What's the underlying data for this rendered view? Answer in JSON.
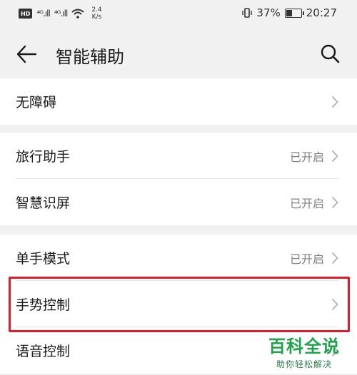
{
  "status_bar": {
    "hd_label": "HD",
    "signal1": "⁴ᴳ.ıll",
    "signal2": "⁴ᴳ.ıll",
    "speed_value": "2.4",
    "speed_unit": "K/s",
    "battery_percent": "37%",
    "battery_level": 0.37,
    "time": "20:27"
  },
  "header": {
    "title": "智能辅助"
  },
  "groups": [
    {
      "items": [
        {
          "label": "无障碍",
          "status": ""
        }
      ]
    },
    {
      "items": [
        {
          "label": "旅行助手",
          "status": "已开启"
        },
        {
          "label": "智慧识屏",
          "status": "已开启"
        }
      ]
    },
    {
      "items": [
        {
          "label": "单手模式",
          "status": "已开启"
        },
        {
          "label": "手势控制",
          "status": ""
        },
        {
          "label": "语音控制",
          "status": ""
        }
      ]
    }
  ],
  "highlighted_item": "手势控制",
  "highlight_color": "#e01b2b",
  "watermark": {
    "main": "百科全说",
    "sub": "助你轻松解决",
    "color": "#1ea34a"
  }
}
